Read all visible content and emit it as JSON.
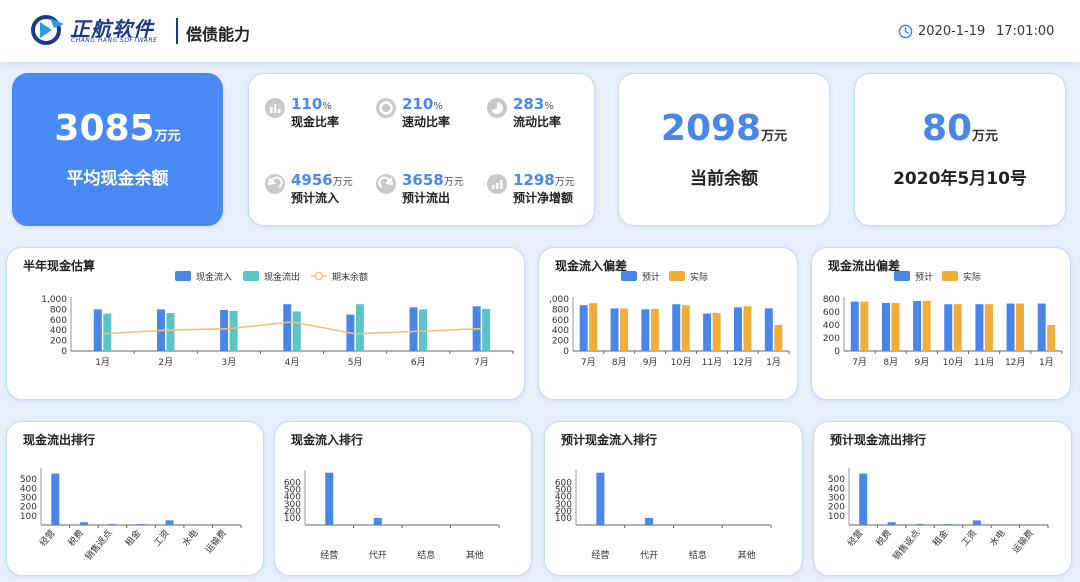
{
  "header": {
    "logo_cn": "正航软件",
    "logo_en": "CHANG HANG SOFTWARE",
    "title": "偿债能力",
    "date": "2020-1-19",
    "time": "17:01:00"
  },
  "kpis": {
    "avg_cash": {
      "value": "3085",
      "unit": "万元",
      "label": "平均现金余额"
    },
    "current_balance": {
      "value": "2098",
      "unit": "万元",
      "label": "当前余额"
    },
    "date_card": {
      "value": "80",
      "unit": "万元",
      "label": "2020年5月10号"
    }
  },
  "ratios": [
    {
      "value": "110",
      "unit": "%",
      "label": "现金比率",
      "icon": "bar-chart-icon"
    },
    {
      "value": "210",
      "unit": "%",
      "label": "速动比率",
      "icon": "donut-icon"
    },
    {
      "value": "283",
      "unit": "%",
      "label": "流动比率",
      "icon": "pie-icon"
    },
    {
      "value": "4956",
      "unit": "万元",
      "label": "预计流入",
      "icon": "inflow-arrow-icon"
    },
    {
      "value": "3658",
      "unit": "万元",
      "label": "预计流出",
      "icon": "outflow-arrow-icon"
    },
    {
      "value": "1298",
      "unit": "万元",
      "label": "预计净增额",
      "icon": "growth-chart-icon"
    }
  ],
  "colors": {
    "blue": "#4a86e8",
    "teal": "#5bc4c4",
    "orange": "#f0ad3a",
    "line": "#f2c07a"
  },
  "chart_data": [
    {
      "title": "半年现金估算",
      "type": "bar",
      "categories": [
        "1月",
        "2月",
        "3月",
        "4月",
        "5月",
        "6月",
        "7月"
      ],
      "series": [
        {
          "name": "现金流入",
          "type": "bar",
          "values": [
            800,
            800,
            790,
            900,
            700,
            840,
            860
          ]
        },
        {
          "name": "现金流出",
          "type": "bar",
          "values": [
            720,
            730,
            770,
            760,
            900,
            800,
            810
          ]
        },
        {
          "name": "期末余额",
          "type": "line",
          "values": [
            330,
            400,
            430,
            560,
            330,
            380,
            430
          ]
        }
      ],
      "ylim": [
        0,
        1000
      ],
      "yticks": [
        "0",
        "200",
        "400",
        "600",
        "800",
        "1,000"
      ],
      "legend": "top-center"
    },
    {
      "title": "现金流入偏差",
      "type": "bar",
      "categories": [
        "7月",
        "8月",
        "9月",
        "10月",
        "11月",
        "12月",
        "1月"
      ],
      "series": [
        {
          "name": "预计",
          "values": [
            880,
            820,
            800,
            900,
            720,
            840,
            820
          ]
        },
        {
          "name": "实际",
          "values": [
            920,
            820,
            810,
            880,
            730,
            860,
            500
          ]
        }
      ],
      "ylim": [
        0,
        1000
      ],
      "yticks": [
        "0",
        "200",
        "400",
        "600",
        "800",
        ",000"
      ],
      "legend": "top-center"
    },
    {
      "title": "现金流出偏差",
      "type": "bar",
      "categories": [
        "7月",
        "8月",
        "9月",
        "10月",
        "11月",
        "12月",
        "1月"
      ],
      "series": [
        {
          "name": "预计",
          "values": [
            760,
            740,
            770,
            720,
            720,
            730,
            730
          ]
        },
        {
          "name": "实际",
          "values": [
            760,
            740,
            770,
            720,
            720,
            730,
            400
          ]
        }
      ],
      "ylim": [
        0,
        800
      ],
      "yticks": [
        "0",
        "200",
        "400",
        "600",
        "800"
      ],
      "legend": "top-center"
    },
    {
      "title": "现金流出排行",
      "type": "bar",
      "categories": [
        "经营",
        "税费",
        "销售返点",
        "租金",
        "工资",
        "水电",
        "运输费"
      ],
      "series": [
        {
          "values": [
            560,
            30,
            10,
            10,
            50,
            0,
            0
          ]
        }
      ],
      "ylim": [
        0,
        600
      ],
      "yticks": [
        "100",
        "200",
        "300",
        "400",
        "500"
      ],
      "rotate_labels": true
    },
    {
      "title": "现金流入排行",
      "type": "bar",
      "categories": [
        "经营",
        "代开",
        "结息",
        "其他"
      ],
      "series": [
        {
          "values": [
            740,
            100,
            0,
            0
          ]
        }
      ],
      "ylim": [
        0,
        750
      ],
      "yticks": [
        "100",
        "200",
        "300",
        "400",
        "500",
        "600"
      ],
      "rotate_labels": false
    },
    {
      "title": "预计现金流入排行",
      "type": "bar",
      "categories": [
        "经营",
        "代开",
        "结息",
        "其他"
      ],
      "series": [
        {
          "values": [
            740,
            100,
            0,
            0
          ]
        }
      ],
      "ylim": [
        0,
        750
      ],
      "yticks": [
        "100",
        "200",
        "300",
        "400",
        "500",
        "600"
      ],
      "rotate_labels": false
    },
    {
      "title": "预计现金流出排行",
      "type": "bar",
      "categories": [
        "经营",
        "税费",
        "销售返点",
        "租金",
        "工资",
        "水电",
        "运输费"
      ],
      "series": [
        {
          "values": [
            560,
            30,
            10,
            10,
            50,
            0,
            0
          ]
        }
      ],
      "ylim": [
        0,
        600
      ],
      "yticks": [
        "100",
        "200",
        "300",
        "400",
        "500"
      ],
      "rotate_labels": true
    }
  ]
}
